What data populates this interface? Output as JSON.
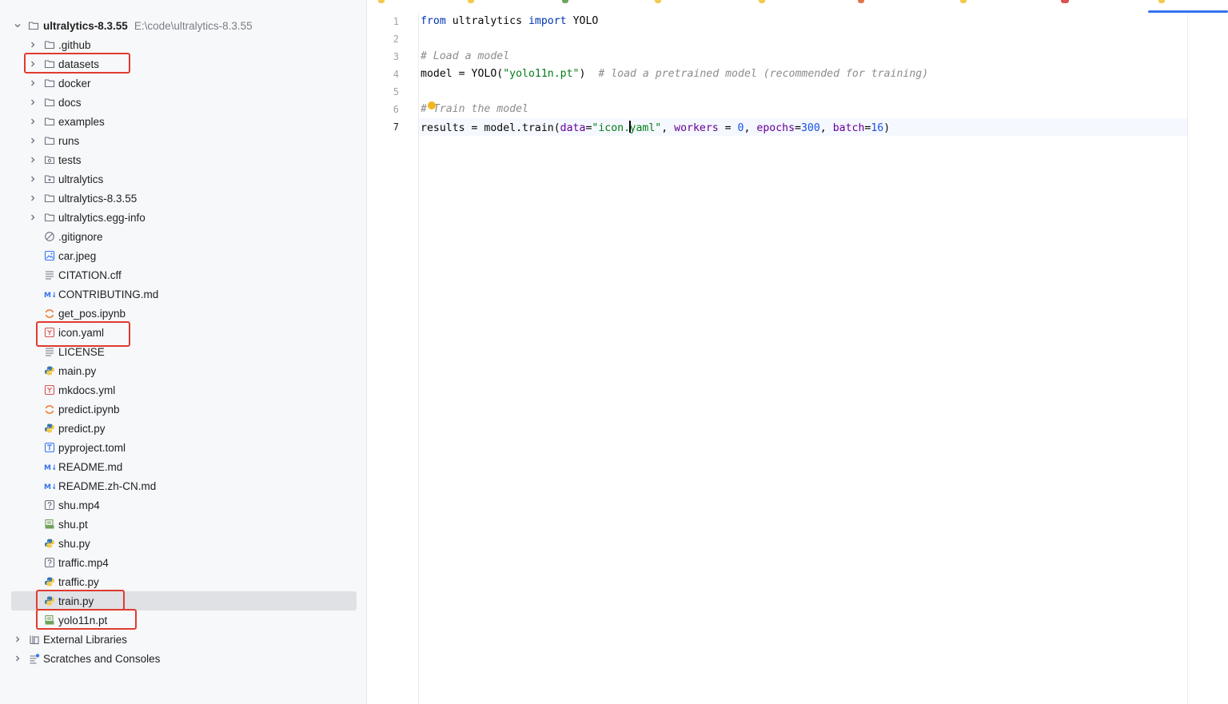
{
  "project_tree": {
    "root": {
      "label": "ultralytics-8.3.55",
      "path": "E:\\code\\ultralytics-8.3.55"
    },
    "items": [
      {
        "label": ".github",
        "icon": "folder-icon",
        "expandable": true
      },
      {
        "label": "datasets",
        "icon": "folder-icon",
        "expandable": true,
        "highlighted": true
      },
      {
        "label": "docker",
        "icon": "folder-icon",
        "expandable": true
      },
      {
        "label": "docs",
        "icon": "folder-icon",
        "expandable": true
      },
      {
        "label": "examples",
        "icon": "folder-icon",
        "expandable": true
      },
      {
        "label": "runs",
        "icon": "folder-icon",
        "expandable": true
      },
      {
        "label": "tests",
        "icon": "test-folder-icon",
        "expandable": true
      },
      {
        "label": "ultralytics",
        "icon": "package-folder-icon",
        "expandable": true
      },
      {
        "label": "ultralytics-8.3.55",
        "icon": "folder-icon",
        "expandable": true
      },
      {
        "label": "ultralytics.egg-info",
        "icon": "folder-icon",
        "expandable": true
      },
      {
        "label": ".gitignore",
        "icon": "ignore-file-icon"
      },
      {
        "label": "car.jpeg",
        "icon": "image-file-icon"
      },
      {
        "label": "CITATION.cff",
        "icon": "text-file-icon"
      },
      {
        "label": "CONTRIBUTING.md",
        "icon": "markdown-file-icon"
      },
      {
        "label": "get_pos.ipynb",
        "icon": "jupyter-file-icon"
      },
      {
        "label": "icon.yaml",
        "icon": "yaml-file-icon",
        "highlighted": true
      },
      {
        "label": "LICENSE",
        "icon": "text-file-icon"
      },
      {
        "label": "main.py",
        "icon": "python-file-icon"
      },
      {
        "label": "mkdocs.yml",
        "icon": "yaml-file-icon"
      },
      {
        "label": "predict.ipynb",
        "icon": "jupyter-file-icon"
      },
      {
        "label": "predict.py",
        "icon": "python-file-icon"
      },
      {
        "label": "pyproject.toml",
        "icon": "toml-file-icon"
      },
      {
        "label": "README.md",
        "icon": "markdown-file-icon"
      },
      {
        "label": "README.zh-CN.md",
        "icon": "markdown-file-icon"
      },
      {
        "label": "shu.mp4",
        "icon": "unknown-file-icon"
      },
      {
        "label": "shu.pt",
        "icon": "pt-file-icon"
      },
      {
        "label": "shu.py",
        "icon": "python-file-icon"
      },
      {
        "label": "traffic.mp4",
        "icon": "unknown-file-icon"
      },
      {
        "label": "traffic.py",
        "icon": "python-file-icon"
      },
      {
        "label": "train.py",
        "icon": "python-file-icon",
        "selected": true,
        "highlighted": true
      },
      {
        "label": "yolo11n.pt",
        "icon": "pt-file-icon",
        "highlighted": true
      }
    ],
    "bottom_items": [
      {
        "label": "External Libraries",
        "icon": "library-icon"
      },
      {
        "label": "Scratches and Consoles",
        "icon": "scratches-icon"
      }
    ]
  },
  "editor": {
    "current_line": 7,
    "line_numbers": [
      "1",
      "2",
      "3",
      "4",
      "5",
      "6",
      "7"
    ],
    "lines": [
      [
        {
          "t": "from",
          "c": "kw"
        },
        {
          "t": " ultralytics "
        },
        {
          "t": "import",
          "c": "kw"
        },
        {
          "t": " YOLO"
        }
      ],
      [],
      [
        {
          "t": "# Load a model",
          "c": "cmt"
        }
      ],
      [
        {
          "t": "model = YOLO("
        },
        {
          "t": "\"yolo11n.pt\"",
          "c": "str"
        },
        {
          "t": ")  "
        },
        {
          "t": "# load a pretrained model (recommended for training)",
          "c": "cmt"
        }
      ],
      [],
      [
        {
          "t": "# Train the model",
          "c": "cmt"
        }
      ],
      [
        {
          "t": "results = model.train("
        },
        {
          "t": "data",
          "c": "param"
        },
        {
          "t": "="
        },
        {
          "t": "\"icon.",
          "c": "str"
        },
        {
          "caret": true
        },
        {
          "t": "yaml\"",
          "c": "str"
        },
        {
          "t": ", "
        },
        {
          "t": "workers",
          "c": "param"
        },
        {
          "t": " = "
        },
        {
          "t": "0",
          "c": "num"
        },
        {
          "t": ", "
        },
        {
          "t": "epochs",
          "c": "param"
        },
        {
          "t": "="
        },
        {
          "t": "300",
          "c": "num"
        },
        {
          "t": ", "
        },
        {
          "t": "batch",
          "c": "param"
        },
        {
          "t": "="
        },
        {
          "t": "16",
          "c": "num"
        },
        {
          "t": ")"
        }
      ]
    ]
  },
  "colors": {
    "highlight_box": "#e03b2f",
    "selection": "#dfe1e5",
    "keyword": "#0033b3",
    "string": "#067d17",
    "comment": "#8c8c8c",
    "param": "#660099",
    "number": "#1750eb",
    "active_tab": "#3574f0"
  }
}
